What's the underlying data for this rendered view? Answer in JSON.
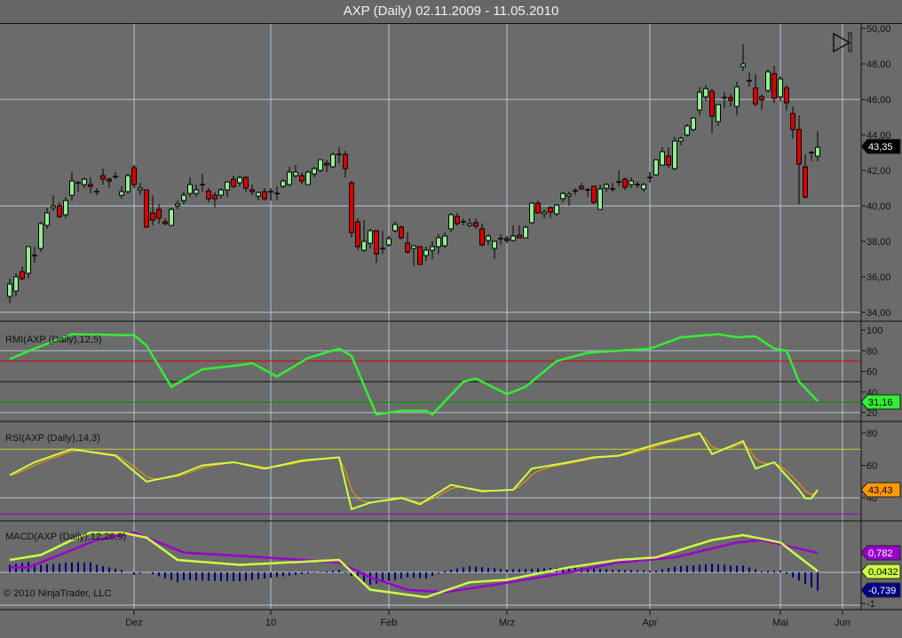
{
  "title": "AXP (Daily)  02.11.2009 - 11.05.2010",
  "copyright": "© 2010 NinjaTrader, LLC",
  "colors": {
    "background": "#6b6b6b",
    "grid": "#b4c4d4",
    "up": "#90ee90",
    "down": "#e00000",
    "rmi": "#33ee33",
    "rsi": "#ccff44",
    "rsi_signal": "#ff9900",
    "macd": "#ccff44",
    "macd_signal": "#9900cc",
    "macd_hist": "#000080"
  },
  "chart_data": [
    {
      "type": "candlestick",
      "name": "price",
      "ylim": [
        34,
        50
      ],
      "y_ticks": [
        "34,00",
        "36,00",
        "38,00",
        "40,00",
        "42,00",
        "44,00",
        "46,00",
        "48,00",
        "50,00"
      ],
      "y_tick_values": [
        34,
        36,
        38,
        40,
        42,
        44,
        46,
        48,
        50
      ],
      "last_value_label": "43,35",
      "last_value": 43.35,
      "x_labels": [
        {
          "label": "Dez",
          "bar": 20
        },
        {
          "label": "10",
          "bar": 42
        },
        {
          "label": "Feb",
          "bar": 61
        },
        {
          "label": "Mrz",
          "bar": 80
        },
        {
          "label": "Apr",
          "bar": 103
        },
        {
          "label": "Mai",
          "bar": 124
        },
        {
          "label": "Jun",
          "bar": 134
        }
      ],
      "ohlc": [
        [
          34.9,
          35.9,
          34.5,
          35.6
        ],
        [
          35.2,
          36.2,
          34.9,
          36.0
        ],
        [
          36.3,
          36.6,
          35.8,
          35.9
        ],
        [
          36.2,
          37.7,
          35.9,
          37.7
        ],
        [
          37.2,
          37.7,
          36.8,
          37.2
        ],
        [
          37.6,
          39.1,
          37.4,
          39.0
        ],
        [
          38.9,
          39.9,
          38.7,
          39.6
        ],
        [
          39.9,
          40.6,
          39.7,
          40.0
        ],
        [
          40.0,
          40.2,
          39.3,
          39.4
        ],
        [
          39.5,
          40.5,
          39.3,
          40.3
        ],
        [
          40.6,
          41.9,
          40.3,
          41.4
        ],
        [
          41.3,
          41.4,
          40.8,
          41.3
        ],
        [
          41.2,
          41.6,
          41.0,
          41.5
        ],
        [
          41.2,
          41.6,
          40.7,
          41.1
        ],
        [
          40.8,
          41.0,
          40.6,
          40.8
        ],
        [
          41.7,
          42.1,
          41.2,
          41.5
        ],
        [
          41.5,
          41.6,
          41.0,
          41.4
        ],
        [
          41.65,
          41.9,
          41.5,
          41.65
        ],
        [
          40.6,
          41.1,
          40.4,
          40.8
        ],
        [
          40.8,
          41.8,
          40.7,
          41.7
        ],
        [
          42.15,
          42.3,
          41.0,
          41.2
        ],
        [
          40.9,
          41.3,
          40.6,
          41.0
        ],
        [
          40.9,
          40.9,
          38.8,
          38.8
        ],
        [
          39.6,
          40.6,
          38.9,
          39.2
        ],
        [
          39.8,
          40.1,
          39.0,
          39.3
        ],
        [
          39.1,
          39.3,
          38.9,
          39.0
        ],
        [
          38.9,
          39.9,
          38.9,
          39.8
        ],
        [
          40.0,
          40.3,
          39.8,
          40.1
        ],
        [
          40.3,
          40.8,
          40.1,
          40.6
        ],
        [
          40.7,
          41.6,
          40.5,
          41.2
        ],
        [
          40.7,
          41.2,
          40.5,
          40.9
        ],
        [
          41.2,
          41.8,
          40.8,
          41.2
        ],
        [
          40.85,
          41.0,
          40.2,
          40.4
        ],
        [
          40.6,
          40.8,
          39.9,
          40.4
        ],
        [
          40.6,
          41.0,
          40.4,
          40.9
        ],
        [
          40.9,
          41.4,
          40.5,
          41.35
        ],
        [
          41.5,
          41.7,
          41.0,
          41.1
        ],
        [
          41.3,
          41.7,
          41.1,
          41.6
        ],
        [
          41.6,
          41.7,
          40.8,
          41.0
        ],
        [
          40.9,
          41.2,
          40.6,
          40.8
        ],
        [
          40.55,
          40.8,
          40.3,
          40.75
        ],
        [
          40.8,
          41.0,
          40.3,
          40.4
        ],
        [
          40.8,
          41.0,
          40.3,
          40.8
        ],
        [
          40.7,
          41.1,
          40.3,
          40.7
        ],
        [
          41.1,
          41.5,
          41.0,
          41.4
        ],
        [
          41.2,
          42.2,
          41.1,
          41.9
        ],
        [
          41.7,
          42.3,
          41.6,
          41.9
        ],
        [
          41.7,
          41.9,
          41.2,
          41.4
        ],
        [
          41.2,
          42.0,
          41.2,
          41.9
        ],
        [
          41.8,
          42.2,
          41.6,
          42.1
        ],
        [
          42.0,
          42.6,
          41.9,
          42.6
        ],
        [
          42.4,
          42.6,
          41.9,
          42.3
        ],
        [
          42.2,
          43.0,
          42.1,
          42.9
        ],
        [
          42.9,
          43.3,
          42.4,
          42.9
        ],
        [
          42.9,
          43.1,
          41.6,
          42.1
        ],
        [
          41.3,
          41.4,
          38.2,
          38.5
        ],
        [
          39.1,
          39.3,
          37.5,
          37.7
        ],
        [
          37.5,
          39.2,
          37.4,
          38.0
        ],
        [
          37.9,
          38.7,
          37.6,
          38.6
        ],
        [
          38.6,
          38.6,
          36.8,
          37.3
        ],
        [
          37.6,
          38.6,
          37.3,
          37.6
        ],
        [
          37.8,
          38.3,
          37.7,
          38.15
        ],
        [
          38.6,
          39.1,
          38.5,
          38.95
        ],
        [
          38.8,
          38.9,
          38.1,
          38.2
        ],
        [
          37.9,
          38.5,
          37.3,
          37.4
        ],
        [
          37.6,
          37.8,
          36.6,
          37.75
        ],
        [
          37.7,
          37.7,
          36.7,
          36.7
        ],
        [
          37.2,
          37.7,
          36.9,
          37.5
        ],
        [
          37.5,
          38.0,
          37.0,
          37.7
        ],
        [
          37.7,
          38.4,
          37.3,
          38.2
        ],
        [
          37.75,
          38.5,
          37.6,
          38.3
        ],
        [
          38.7,
          39.6,
          38.5,
          39.5
        ],
        [
          39.4,
          39.6,
          38.9,
          39.0
        ],
        [
          39.1,
          39.3,
          38.9,
          39.1
        ],
        [
          38.9,
          39.3,
          38.8,
          39.0
        ],
        [
          39.05,
          39.3,
          38.7,
          38.85
        ],
        [
          38.7,
          39.0,
          37.7,
          37.8
        ],
        [
          38.05,
          38.4,
          37.8,
          38.3
        ],
        [
          37.6,
          38.0,
          37.0,
          38.0
        ],
        [
          38.15,
          38.4,
          37.8,
          38.15
        ],
        [
          38.15,
          38.3,
          37.9,
          38.05
        ],
        [
          38.05,
          38.9,
          38.0,
          38.3
        ],
        [
          38.35,
          38.9,
          38.2,
          38.2
        ],
        [
          38.2,
          38.9,
          38.2,
          38.8
        ],
        [
          39.05,
          40.2,
          39.0,
          40.15
        ],
        [
          40.15,
          40.3,
          39.6,
          39.6
        ],
        [
          39.55,
          39.8,
          39.3,
          39.65
        ],
        [
          39.9,
          40.0,
          39.3,
          39.65
        ],
        [
          39.55,
          40.1,
          39.4,
          40.05
        ],
        [
          40.4,
          40.8,
          40.2,
          40.7
        ],
        [
          40.55,
          40.8,
          40.0,
          40.65
        ],
        [
          40.85,
          41.0,
          40.6,
          40.85
        ],
        [
          41.1,
          41.3,
          40.9,
          40.95
        ],
        [
          40.9,
          41.0,
          40.5,
          40.9
        ],
        [
          41.1,
          41.1,
          40.1,
          40.2
        ],
        [
          39.8,
          41.2,
          39.8,
          40.95
        ],
        [
          41.0,
          41.3,
          40.8,
          41.2
        ],
        [
          40.95,
          41.3,
          40.8,
          40.95
        ],
        [
          41.35,
          42.0,
          41.1,
          41.35
        ],
        [
          41.5,
          41.6,
          40.9,
          41.05
        ],
        [
          41.2,
          41.6,
          41.0,
          41.4
        ],
        [
          41.2,
          41.4,
          41.0,
          41.2
        ],
        [
          40.95,
          41.3,
          40.8,
          41.2
        ],
        [
          41.6,
          41.9,
          41.3,
          41.6
        ],
        [
          41.75,
          42.6,
          41.7,
          42.6
        ],
        [
          42.3,
          43.3,
          42.3,
          43.05
        ],
        [
          42.8,
          43.3,
          42.1,
          42.3
        ],
        [
          42.1,
          43.9,
          42.0,
          43.65
        ],
        [
          43.65,
          43.9,
          43.4,
          43.8
        ],
        [
          44.0,
          44.6,
          43.9,
          44.5
        ],
        [
          44.3,
          45.0,
          44.2,
          44.95
        ],
        [
          45.4,
          46.7,
          45.1,
          46.4
        ],
        [
          46.15,
          46.8,
          45.9,
          46.6
        ],
        [
          46.45,
          46.6,
          44.1,
          45.05
        ],
        [
          44.75,
          45.7,
          44.5,
          45.7
        ],
        [
          46.1,
          46.4,
          45.5,
          46.1
        ],
        [
          46.1,
          46.3,
          45.6,
          45.95
        ],
        [
          45.6,
          47.0,
          45.1,
          46.7
        ],
        [
          47.85,
          49.1,
          47.6,
          48.0
        ],
        [
          47.05,
          47.5,
          46.7,
          47.05
        ],
        [
          46.65,
          47.4,
          45.6,
          45.75
        ],
        [
          46.15,
          46.3,
          45.4,
          45.98
        ],
        [
          46.5,
          47.7,
          46.4,
          47.55
        ],
        [
          47.45,
          47.9,
          45.8,
          46.05
        ],
        [
          46.15,
          47.3,
          45.9,
          47.15
        ],
        [
          46.65,
          46.8,
          45.4,
          45.8
        ],
        [
          45.2,
          45.6,
          43.8,
          44.3
        ],
        [
          44.3,
          45.1,
          40.1,
          42.35
        ],
        [
          42.2,
          42.9,
          40.4,
          40.5
        ],
        [
          42.95,
          43.1,
          42.5,
          43.0
        ],
        [
          42.8,
          44.2,
          42.5,
          43.3
        ]
      ]
    },
    {
      "type": "line",
      "name": "RMI",
      "label": "RMI(AXP (Daily),12,5)",
      "ylim": [
        10,
        108
      ],
      "y_ticks": [
        "20",
        "40",
        "60",
        "80",
        "100"
      ],
      "y_tick_values": [
        20,
        40,
        60,
        80,
        100
      ],
      "levels": [
        {
          "value": 70,
          "color": "#dd0000"
        },
        {
          "value": 50,
          "color": "#111111"
        },
        {
          "value": 30,
          "color": "#009900"
        }
      ],
      "last_value_label": "31,16",
      "points": [
        [
          0,
          72
        ],
        [
          4,
          82
        ],
        [
          10,
          96
        ],
        [
          20,
          95
        ],
        [
          22,
          85
        ],
        [
          26,
          45
        ],
        [
          31,
          62
        ],
        [
          37,
          66
        ],
        [
          39,
          68
        ],
        [
          43,
          55
        ],
        [
          48,
          73
        ],
        [
          53,
          82
        ],
        [
          55,
          75
        ],
        [
          59,
          18
        ],
        [
          63,
          22
        ],
        [
          67,
          22
        ],
        [
          68,
          18
        ],
        [
          73,
          50
        ],
        [
          75,
          53
        ],
        [
          80,
          38
        ],
        [
          83,
          45
        ],
        [
          86,
          60
        ],
        [
          88,
          70
        ],
        [
          93,
          78
        ],
        [
          98,
          80
        ],
        [
          103,
          82
        ],
        [
          108,
          93
        ],
        [
          114,
          96
        ],
        [
          117,
          93
        ],
        [
          120,
          94
        ],
        [
          123,
          82
        ],
        [
          125,
          80
        ],
        [
          127,
          50
        ],
        [
          130,
          31.16
        ]
      ]
    },
    {
      "type": "line",
      "name": "RSI",
      "label": "RSI(AXP (Daily),14,3)",
      "y_ticks": [
        "40",
        "60",
        "80"
      ],
      "y_tick_values": [
        40,
        60,
        80
      ],
      "levels": [
        {
          "value": 70,
          "color": "#cccc33"
        },
        {
          "value": 30,
          "color": "#9900cc"
        }
      ],
      "last_value_label": "43,43",
      "points": [
        [
          0,
          54
        ],
        [
          4,
          62
        ],
        [
          10,
          70
        ],
        [
          17,
          66
        ],
        [
          22,
          50
        ],
        [
          27,
          54
        ],
        [
          31,
          60
        ],
        [
          36,
          62
        ],
        [
          41,
          58
        ],
        [
          47,
          63
        ],
        [
          53,
          65
        ],
        [
          55,
          33
        ],
        [
          58,
          37
        ],
        [
          63,
          40
        ],
        [
          66,
          36
        ],
        [
          71,
          48
        ],
        [
          76,
          44
        ],
        [
          81,
          45
        ],
        [
          84,
          58
        ],
        [
          90,
          62
        ],
        [
          94,
          65
        ],
        [
          98,
          66
        ],
        [
          104,
          73
        ],
        [
          111,
          80
        ],
        [
          113,
          67
        ],
        [
          118,
          75
        ],
        [
          120,
          58
        ],
        [
          123,
          62
        ],
        [
          127,
          45
        ],
        [
          128.5,
          37
        ],
        [
          130,
          45
        ]
      ]
    },
    {
      "type": "line",
      "name": "MACD",
      "label": "MACD(AXP (Daily),12,26,9)",
      "y_ticks": [
        "-1"
      ],
      "y_tick_values": [
        -1
      ],
      "labels": {
        "signal": "0,782",
        "macd": "0,0432",
        "diff": "-0,739"
      },
      "macd": [
        [
          0,
          0.5
        ],
        [
          5,
          0.7
        ],
        [
          10,
          1.3
        ],
        [
          13,
          1.6
        ],
        [
          18,
          1.6
        ],
        [
          22,
          1.4
        ],
        [
          27,
          0.5
        ],
        [
          37,
          0.3
        ],
        [
          53,
          0.5
        ],
        [
          58,
          -0.7
        ],
        [
          64,
          -0.9
        ],
        [
          67,
          -1.0
        ],
        [
          74,
          -0.4
        ],
        [
          80,
          -0.3
        ],
        [
          90,
          0.2
        ],
        [
          98,
          0.5
        ],
        [
          104,
          0.6
        ],
        [
          113,
          1.3
        ],
        [
          118,
          1.5
        ],
        [
          124,
          1.2
        ],
        [
          130,
          0.0432
        ]
      ],
      "signal": [
        [
          0,
          0.2
        ],
        [
          3,
          0.2
        ],
        [
          14,
          1.3
        ],
        [
          20,
          1.6
        ],
        [
          28,
          0.8
        ],
        [
          41,
          0.6
        ],
        [
          53,
          0.4
        ],
        [
          58,
          -0.2
        ],
        [
          64,
          -0.7
        ],
        [
          70,
          -0.8
        ],
        [
          78,
          -0.5
        ],
        [
          90,
          0
        ],
        [
          98,
          0.4
        ],
        [
          107,
          0.6
        ],
        [
          117,
          1.2
        ],
        [
          121,
          1.3
        ],
        [
          130,
          0.782
        ]
      ]
    }
  ]
}
